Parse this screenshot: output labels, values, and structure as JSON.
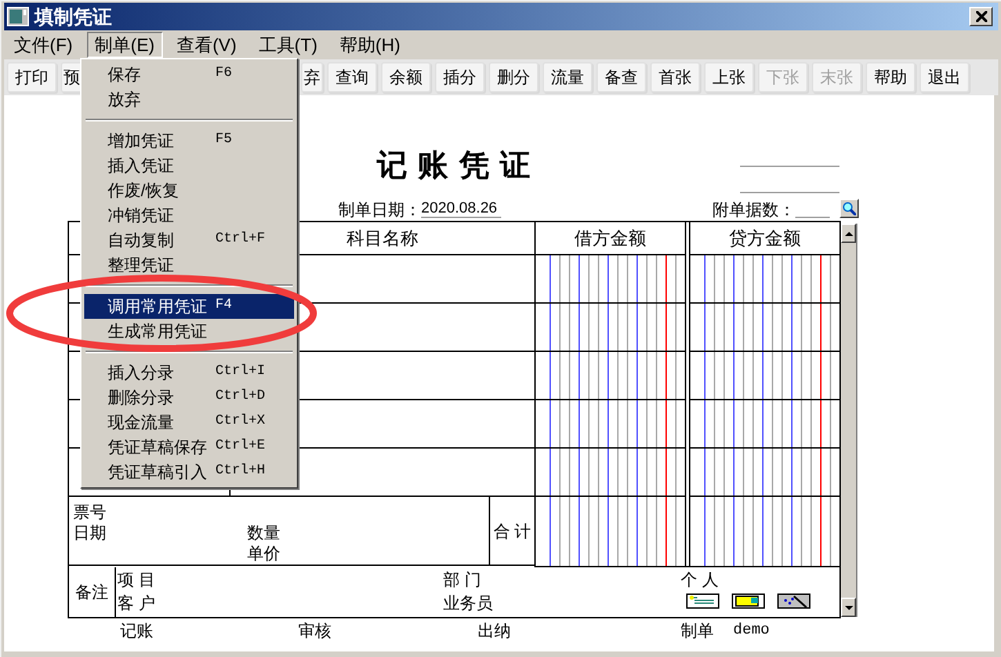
{
  "window": {
    "title": "填制凭证"
  },
  "menu_bar": [
    {
      "label": "文件(F)",
      "selected": false
    },
    {
      "label": "制单(E)",
      "selected": true
    },
    {
      "label": "查看(V)",
      "selected": false
    },
    {
      "label": "工具(T)",
      "selected": false
    },
    {
      "label": "帮助(H)",
      "selected": false
    }
  ],
  "toolbar_left": [
    {
      "label": "打印",
      "disabled": false
    },
    {
      "label": "预",
      "disabled": false
    }
  ],
  "toolbar_right": [
    {
      "label": "弃",
      "disabled": false
    },
    {
      "label": "查询",
      "disabled": false
    },
    {
      "label": "余额",
      "disabled": false
    },
    {
      "label": "插分",
      "disabled": false
    },
    {
      "label": "删分",
      "disabled": false
    },
    {
      "label": "流量",
      "disabled": false
    },
    {
      "label": "备查",
      "disabled": false
    },
    {
      "label": "首张",
      "disabled": false
    },
    {
      "label": "上张",
      "disabled": false
    },
    {
      "label": "下张",
      "disabled": true
    },
    {
      "label": "末张",
      "disabled": true
    },
    {
      "label": "帮助",
      "disabled": false
    },
    {
      "label": "退出",
      "disabled": false
    }
  ],
  "dropdown_menu": [
    {
      "kind": "item",
      "label": "保存",
      "shortcut": "F6",
      "selected": false
    },
    {
      "kind": "item",
      "label": "放弃",
      "selected": false
    },
    {
      "kind": "separator"
    },
    {
      "kind": "item",
      "label": "增加凭证",
      "shortcut": "F5",
      "selected": false
    },
    {
      "kind": "item",
      "label": "插入凭证",
      "selected": false
    },
    {
      "kind": "item",
      "label": "作废/恢复",
      "selected": false
    },
    {
      "kind": "item",
      "label": "冲销凭证",
      "selected": false
    },
    {
      "kind": "item",
      "label": "自动复制",
      "shortcut": "Ctrl+F",
      "selected": false
    },
    {
      "kind": "item",
      "label": "整理凭证",
      "selected": false
    },
    {
      "kind": "separator"
    },
    {
      "kind": "item",
      "label": "调用常用凭证",
      "shortcut": "F4",
      "selected": true
    },
    {
      "kind": "item",
      "label": "生成常用凭证",
      "selected": false
    },
    {
      "kind": "separator"
    },
    {
      "kind": "item",
      "label": "插入分录",
      "shortcut": "Ctrl+I",
      "selected": false
    },
    {
      "kind": "item",
      "label": "删除分录",
      "shortcut": "Ctrl+D",
      "selected": false
    },
    {
      "kind": "item",
      "label": "现金流量",
      "shortcut": "Ctrl+X",
      "selected": false
    },
    {
      "kind": "item",
      "label": "凭证草稿保存",
      "shortcut": "Ctrl+E",
      "selected": false
    },
    {
      "kind": "item",
      "label": "凭证草稿引入",
      "shortcut": "Ctrl+H",
      "selected": false
    }
  ],
  "voucher": {
    "title": "记 账 凭 证",
    "date_label": "制单日期：",
    "date": "2020.08.26",
    "attachments_label": "附单据数：",
    "columns": [
      "科目名称",
      "借方金额",
      "贷方金额"
    ],
    "summary": {
      "ticket_label": "票号",
      "date_label": "日期",
      "quantity_label": "数量",
      "price_label": "单价",
      "total_label": "合 计"
    },
    "notes": {
      "label": "备注",
      "project_label": "项 目",
      "customer_label": "客 户",
      "department_label": "部 门",
      "salesperson_label": "业务员",
      "person_label": "个 人"
    },
    "signatures": [
      {
        "label": "记账"
      },
      {
        "label": "审核"
      },
      {
        "label": "出纳"
      },
      {
        "label": "制单",
        "value": "demo"
      }
    ]
  }
}
